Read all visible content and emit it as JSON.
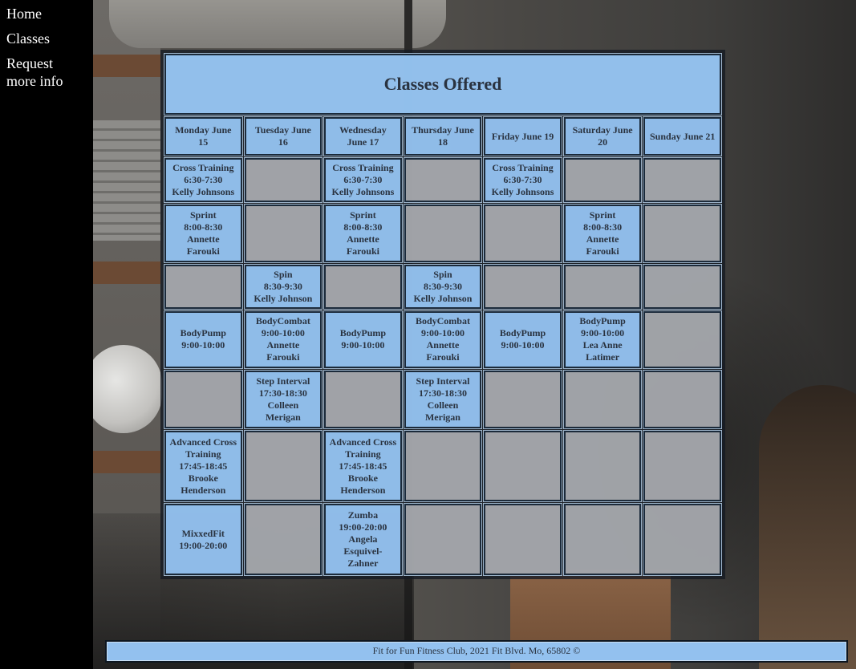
{
  "nav": {
    "items": [
      "Home",
      "Classes",
      "Request more info"
    ]
  },
  "schedule": {
    "title": "Classes Offered",
    "days": [
      "Monday June 15",
      "Tuesday June 16",
      "Wednesday June 17",
      "Thursday June 18",
      "Friday June 19",
      "Saturday June 20",
      "Sunday June 21"
    ],
    "rows": [
      [
        [
          "Cross Training",
          "6:30-7:30",
          "Kelly Johnsons"
        ],
        [],
        [
          "Cross Training",
          "6:30-7:30",
          "Kelly Johnsons"
        ],
        [],
        [
          "Cross Training",
          "6:30-7:30",
          "Kelly Johnsons"
        ],
        [],
        []
      ],
      [
        [
          "Sprint",
          "8:00-8:30",
          "Annette Farouki"
        ],
        [],
        [
          "Sprint",
          "8:00-8:30",
          "Annette Farouki"
        ],
        [],
        [],
        [
          "Sprint",
          "8:00-8:30",
          "Annette Farouki"
        ],
        []
      ],
      [
        [],
        [
          "Spin",
          "8:30-9:30",
          "Kelly Johnson"
        ],
        [],
        [
          "Spin",
          "8:30-9:30",
          "Kelly Johnson"
        ],
        [],
        [],
        []
      ],
      [
        [
          "BodyPump",
          "9:00-10:00"
        ],
        [
          "BodyCombat",
          "9:00-10:00",
          "Annette Farouki"
        ],
        [
          "BodyPump",
          "9:00-10:00"
        ],
        [
          "BodyCombat",
          "9:00-10:00",
          "Annette Farouki"
        ],
        [
          "BodyPump",
          "9:00-10:00"
        ],
        [
          "BodyPump",
          "9:00-10:00",
          "Lea Anne Latimer"
        ],
        []
      ],
      [
        [],
        [
          "Step Interval",
          "17:30-18:30",
          "Colleen Merigan"
        ],
        [],
        [
          "Step Interval",
          "17:30-18:30",
          "Colleen Merigan"
        ],
        [],
        [],
        []
      ],
      [
        [
          "Advanced Cross Training",
          "17:45-18:45",
          "Brooke Henderson"
        ],
        [],
        [
          "Advanced Cross Training",
          "17:45-18:45",
          "Brooke Henderson"
        ],
        [],
        [],
        [],
        []
      ],
      [
        [
          "MixxedFit",
          "19:00-20:00"
        ],
        [],
        [
          "Zumba",
          "19:00-20:00",
          "Angela Esquivel-Zahner"
        ],
        [],
        [],
        [],
        []
      ]
    ]
  },
  "footer": {
    "text": "Fit for Fun Fitness Club, 2021 Fit Blvd. Mo, 65802 ©"
  },
  "colors": {
    "cell_blue": "#96c4f2",
    "cell_gray": "#b2b4b8",
    "nav_bg": "#000000",
    "nav_text": "#ffffff"
  }
}
